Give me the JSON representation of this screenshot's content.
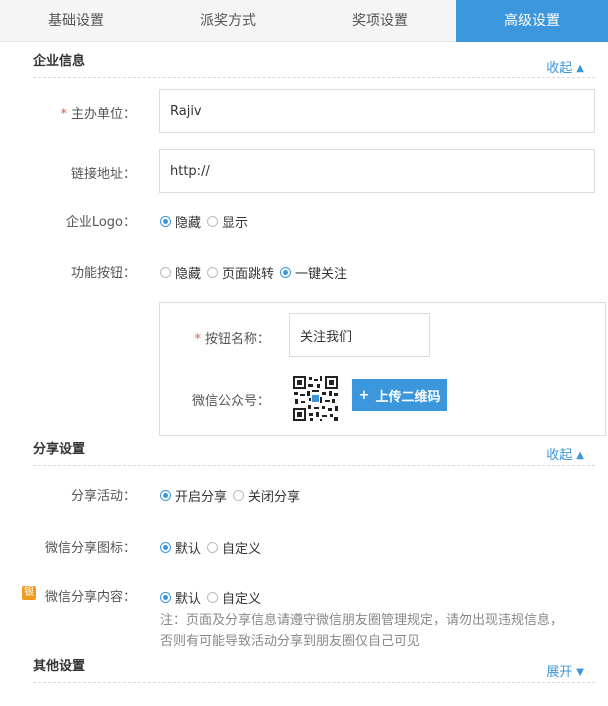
{
  "tabs": [
    {
      "label": "基础设置"
    },
    {
      "label": "派奖方式"
    },
    {
      "label": "奖项设置"
    },
    {
      "label": "高级设置",
      "active": true
    }
  ],
  "enterprise": {
    "title": "企业信息",
    "collapse_label": "收起",
    "host_label": "主办单位：",
    "host_value": "Rajiv",
    "link_label": "链接地址：",
    "link_value": "http://",
    "logo_label": "企业Logo：",
    "logo_options": [
      "隐藏",
      "显示"
    ],
    "logo_selected": "隐藏",
    "func_label": "功能按钮：",
    "func_options": [
      "隐藏",
      "页面跳转",
      "一键关注"
    ],
    "func_selected": "一键关注",
    "button_name_label": "按钮名称：",
    "button_name_value": "关注我们",
    "wechat_label": "微信公众号：",
    "upload_label": "上传二维码"
  },
  "share": {
    "title": "分享设置",
    "collapse_label": "收起",
    "activity_label": "分享活动：",
    "activity_options": [
      "开启分享",
      "关闭分享"
    ],
    "activity_selected": "开启分享",
    "icon_label": "微信分享图标：",
    "icon_options": [
      "默认",
      "自定义"
    ],
    "icon_selected": "默认",
    "badge": "银",
    "content_label": "微信分享内容：",
    "content_options": [
      "默认",
      "自定义"
    ],
    "content_selected": "默认",
    "note_line1": "注：页面及分享信息请遵守微信朋友圈管理规定，请勿出现违规信息，",
    "note_line2": "否则有可能导致活动分享到朋友圈仅自己可见"
  },
  "other": {
    "title": "其他设置",
    "expand_label": "展开"
  },
  "colors": {
    "accent": "#3c96db",
    "required": "#e8584a",
    "badge": "#f39a1e"
  }
}
